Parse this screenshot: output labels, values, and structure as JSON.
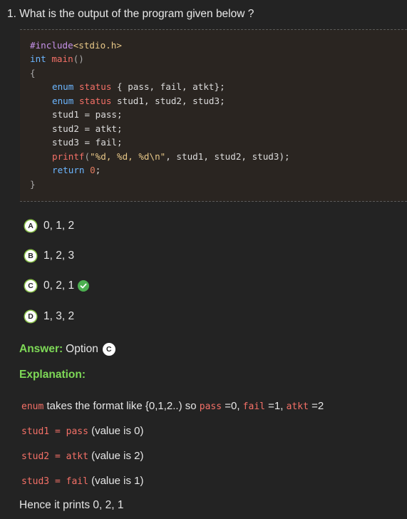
{
  "question": "1. What is the output of the program given below ?",
  "code": {
    "l1_pp": "#include",
    "l1_hdr": "<stdio.h>",
    "l2_type": "int",
    "l2_fn": "main",
    "l2_parens": "()",
    "l3": "{",
    "l4_kw": "enum",
    "l4_type": "status",
    "l4_rest": "{ pass, fail, atkt};",
    "l5_kw": "enum",
    "l5_type": "status",
    "l5_rest": "stud1, stud2, stud3;",
    "l6": "stud1 = pass;",
    "l7": "stud2 = atkt;",
    "l8": "stud3 = fail;",
    "l9_fn": "printf",
    "l9_open": "(",
    "l9_str": "\"%d, %d, %d\\n\"",
    "l9_rest": ", stud1, stud2, stud3);",
    "l10_kw": "return",
    "l10_num": "0",
    "l10_semi": ";",
    "l11": "}"
  },
  "options": [
    {
      "letter": "A",
      "text": "0, 1, 2"
    },
    {
      "letter": "B",
      "text": "1, 2, 3"
    },
    {
      "letter": "C",
      "text": "0, 2, 1",
      "correct": true
    },
    {
      "letter": "D",
      "text": "1, 3, 2"
    }
  ],
  "answer": {
    "label": "Answer:",
    "text": "Option",
    "letter": "C"
  },
  "explanation": {
    "title": "Explanation:",
    "line1": {
      "t1": "enum",
      "t2": " takes the format like {0,1,2..) so ",
      "t3": "pass",
      "t4": " =0, ",
      "t5": "fail",
      "t6": " =1, ",
      "t7": "atkt",
      "t8": " =2"
    },
    "line2": {
      "code": "stud1 = pass",
      "text": " (value is 0)"
    },
    "line3": {
      "code": "stud2 = atkt",
      "text": " (value is 2)"
    },
    "line4": {
      "code": "stud3 = fail",
      "text": " (value is 1)"
    },
    "hence": "Hence it prints 0, 2, 1"
  },
  "colors": {
    "accent_green": "#7ed957",
    "check_green": "#4caf50",
    "code_red": "#f47067",
    "keyword_blue": "#6cb6ff"
  }
}
